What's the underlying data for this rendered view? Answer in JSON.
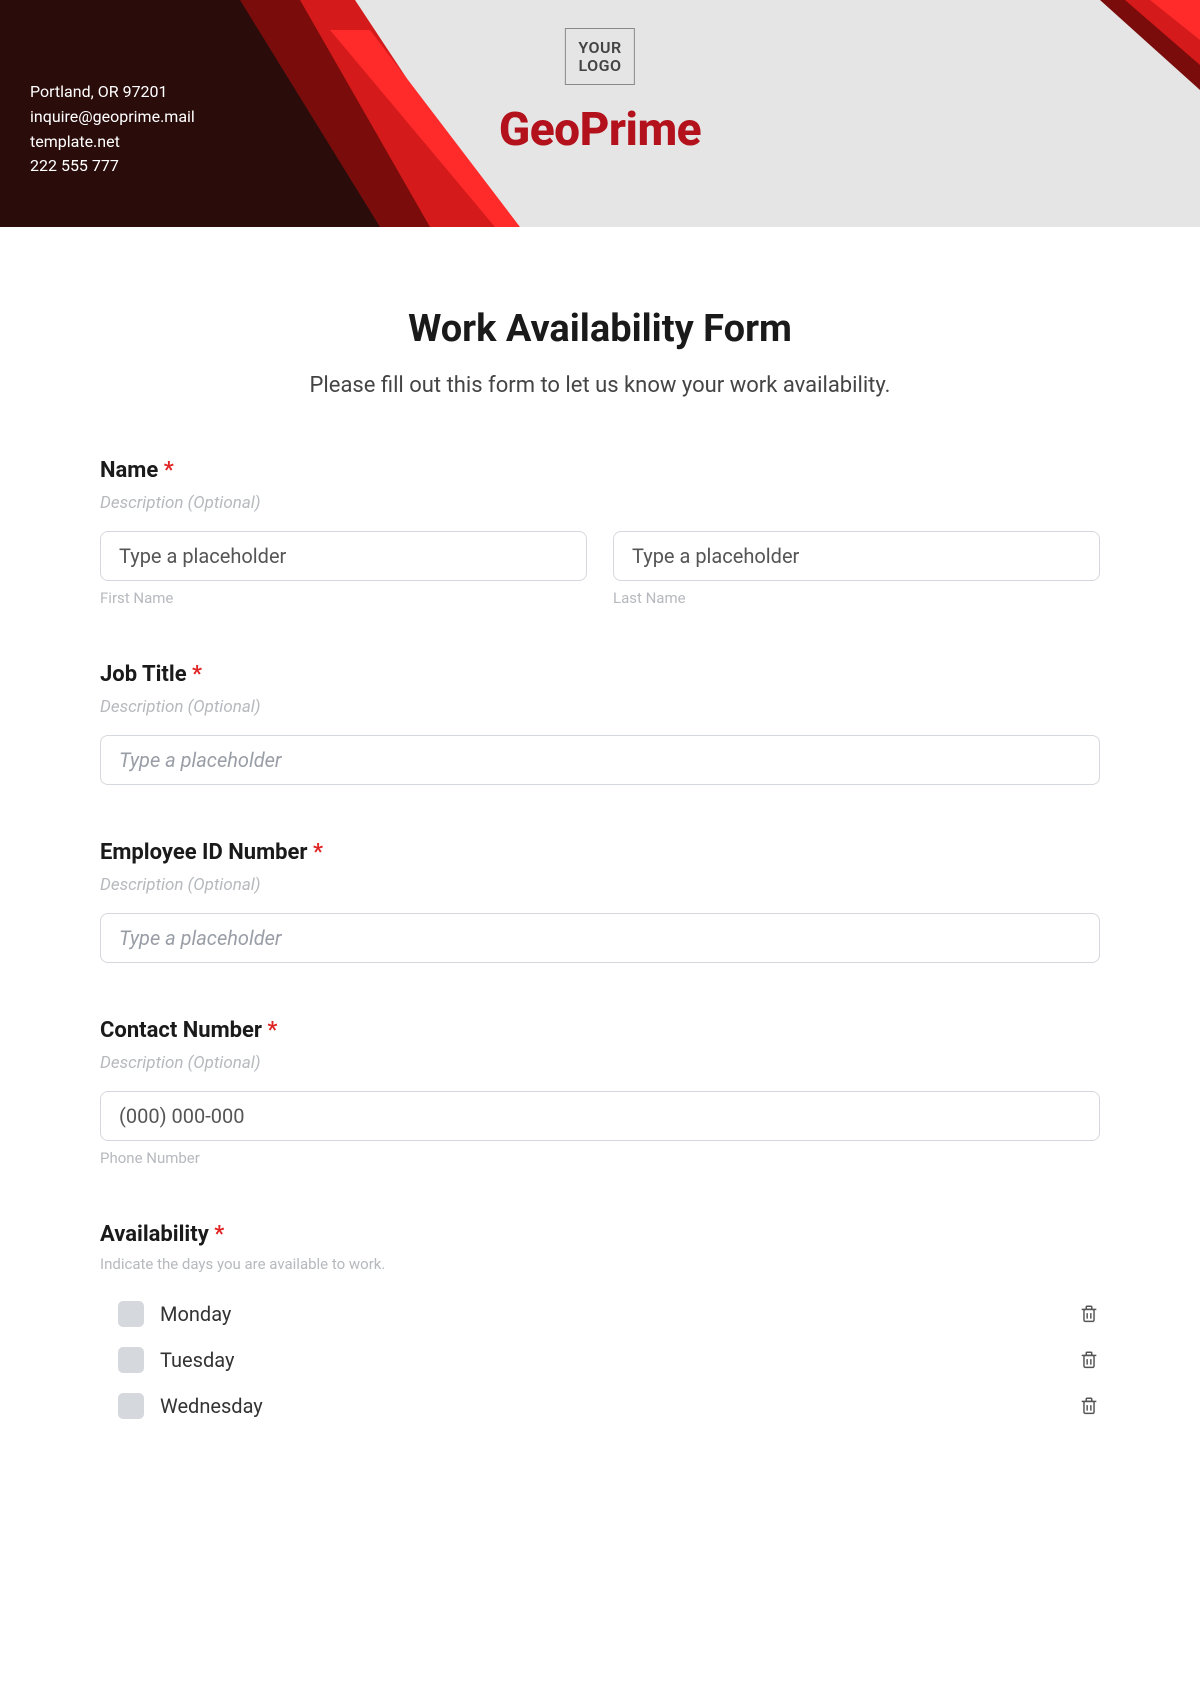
{
  "header": {
    "contact": {
      "line1": "Portland, OR 97201",
      "line2": "inquire@geoprime.mail",
      "line3": "template.net",
      "line4": "222 555 777"
    },
    "logo_line1": "YOUR",
    "logo_line2": "LOGO",
    "brand": "GeoPrime"
  },
  "form": {
    "title": "Work Availability Form",
    "intro": "Please fill out this form to let us know your work availability.",
    "name": {
      "label": "Name",
      "desc": "Description (Optional)",
      "first_placeholder": "Type a placeholder",
      "last_placeholder": "Type a placeholder",
      "first_sub": "First Name",
      "last_sub": "Last Name"
    },
    "job": {
      "label": "Job Title",
      "desc": "Description (Optional)",
      "placeholder": "Type a placeholder"
    },
    "empid": {
      "label": "Employee ID Number",
      "desc": "Description (Optional)",
      "placeholder": "Type a placeholder"
    },
    "contact": {
      "label": "Contact Number",
      "desc": "Description (Optional)",
      "placeholder": "(000) 000-000",
      "sub": "Phone Number"
    },
    "availability": {
      "label": "Availability",
      "helper": "Indicate the days you are available to work.",
      "day0": "Monday",
      "day1": "Tuesday",
      "day2": "Wednesday"
    }
  },
  "colors": {
    "brand_red": "#b3121c",
    "accent_red": "#e02424"
  }
}
